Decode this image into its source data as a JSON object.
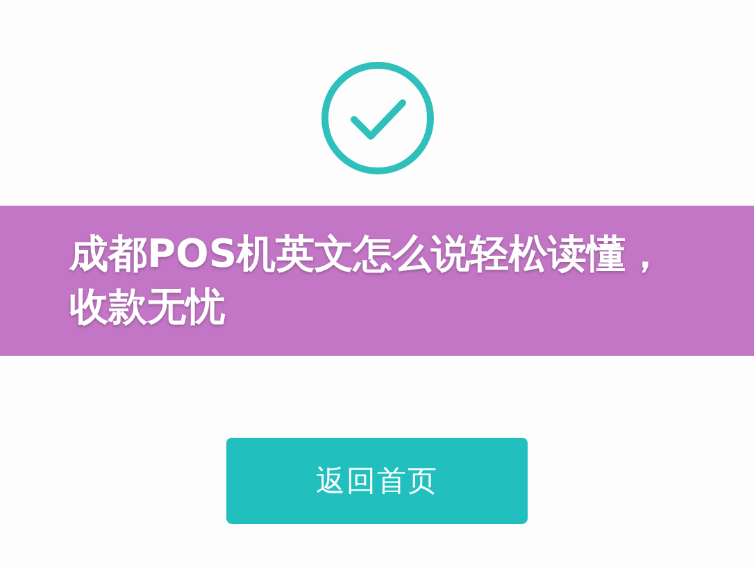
{
  "banner": {
    "title": "成都POS机英文怎么说轻松读懂，收款无忧"
  },
  "button": {
    "label": "返回首页"
  }
}
